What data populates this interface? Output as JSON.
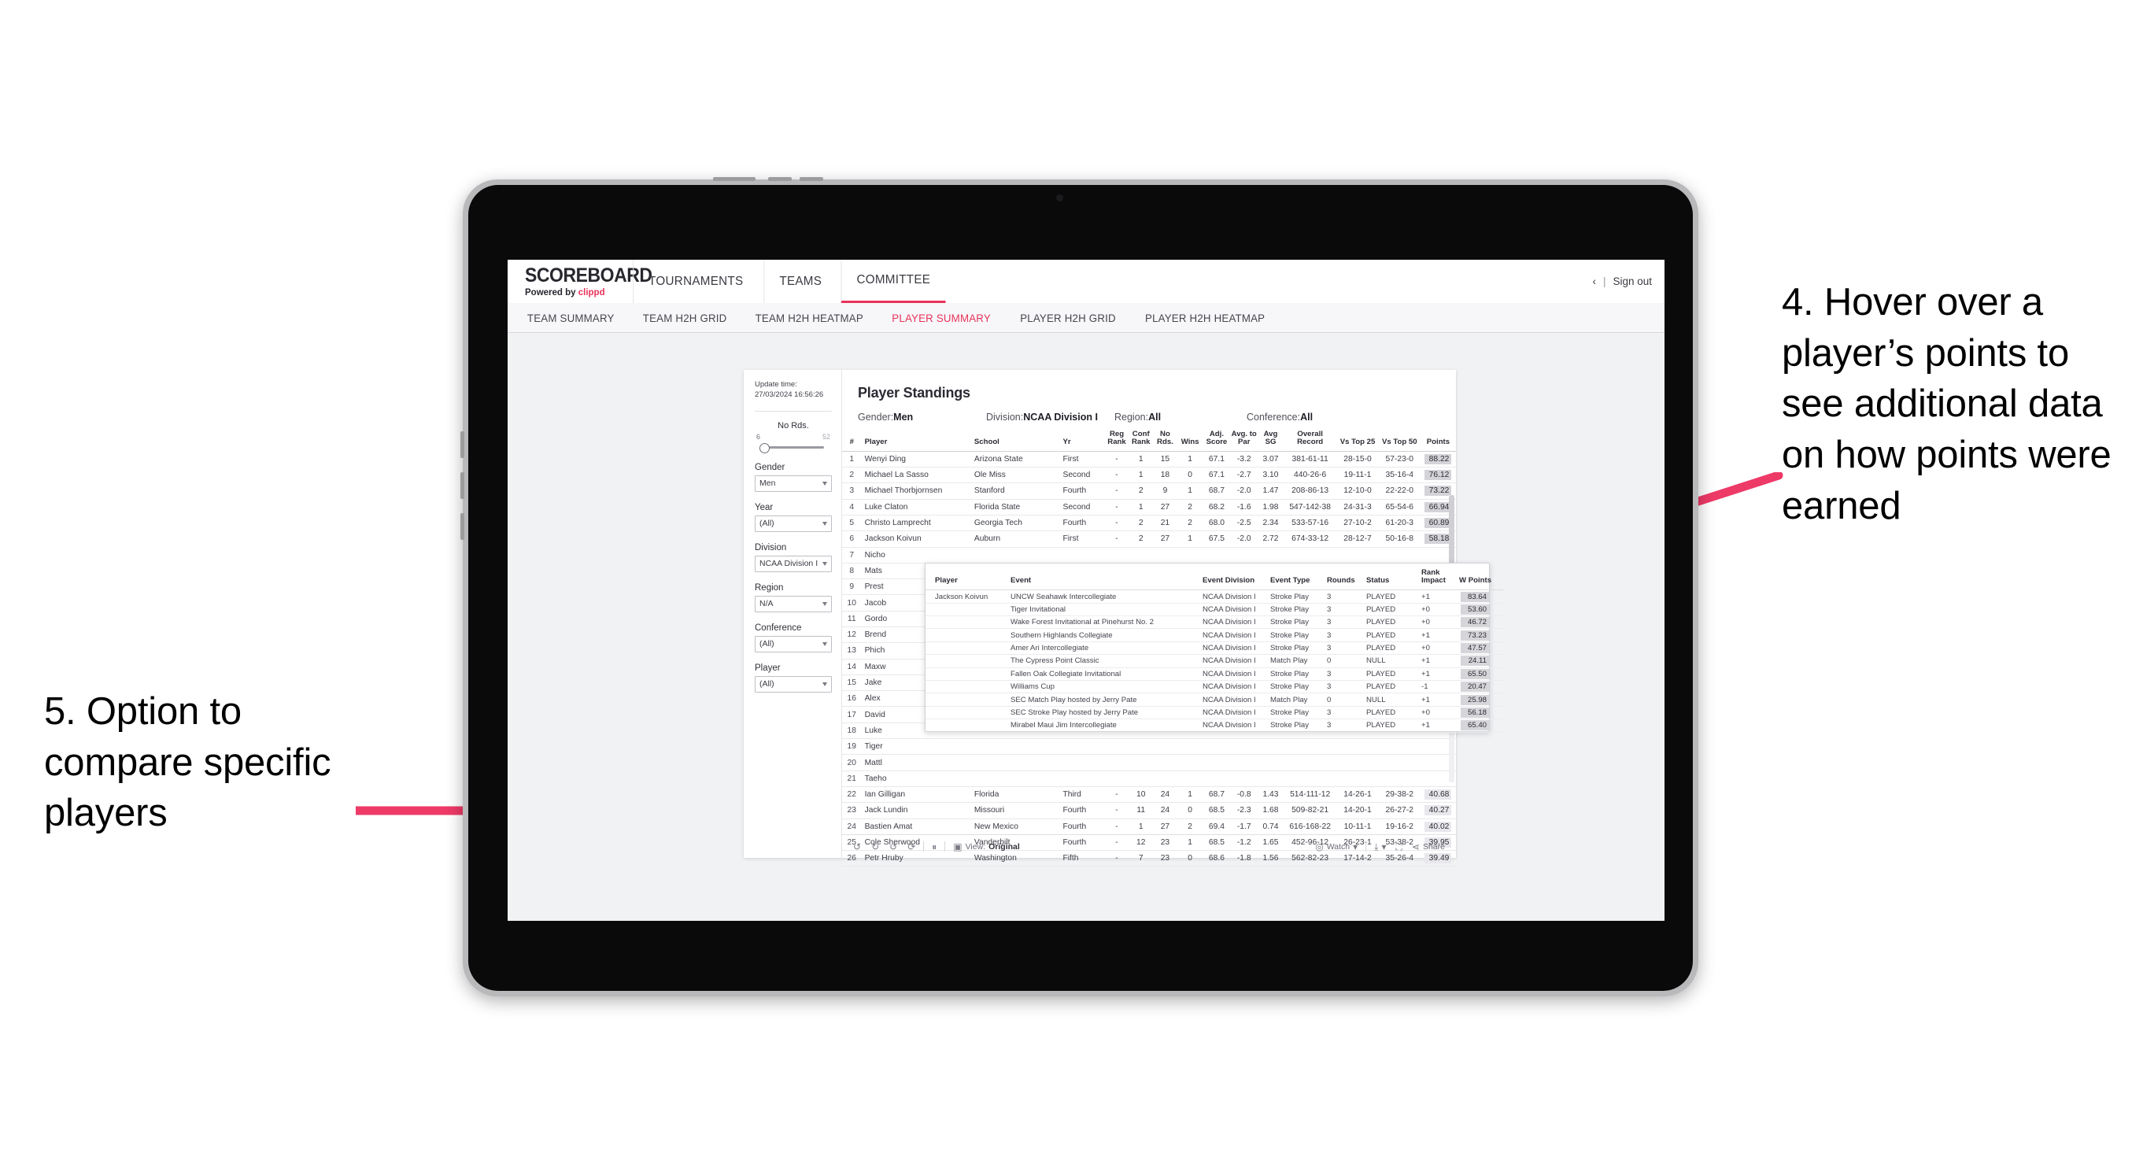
{
  "annotations": {
    "right": "4. Hover over a player’s points to see additional data on how points were earned",
    "left": "5. Option to compare specific players",
    "arrow_color": "#EE3A67"
  },
  "header": {
    "brand_title": "SCOREBOARD",
    "brand_sub_prefix": "Powered by ",
    "brand_sub_brand": "clippd",
    "nav": [
      {
        "label": "TOURNAMENTS",
        "active": false
      },
      {
        "label": "TEAMS",
        "active": false
      },
      {
        "label": "COMMITTEE",
        "active": true
      }
    ],
    "account_chevron": "‹",
    "separator": "|",
    "sign_out": "Sign out"
  },
  "subnav": [
    {
      "label": "TEAM SUMMARY",
      "active": false
    },
    {
      "label": "TEAM H2H GRID",
      "active": false
    },
    {
      "label": "TEAM H2H HEATMAP",
      "active": false
    },
    {
      "label": "PLAYER SUMMARY",
      "active": true
    },
    {
      "label": "PLAYER H2H GRID",
      "active": false
    },
    {
      "label": "PLAYER H2H HEATMAP",
      "active": false
    }
  ],
  "sidebar": {
    "update_time_label": "Update time:",
    "update_time_value": "27/03/2024 16:56:26",
    "slider": {
      "title": "No Rds.",
      "min": "6",
      "max": "52"
    },
    "filters": [
      {
        "label": "Gender",
        "value": "Men"
      },
      {
        "label": "Year",
        "value": "(All)"
      },
      {
        "label": "Division",
        "value": "NCAA Division I"
      },
      {
        "label": "Region",
        "value": "N/A"
      },
      {
        "label": "Conference",
        "value": "(All)"
      },
      {
        "label": "Player",
        "value": "(All)"
      }
    ]
  },
  "viz": {
    "title": "Player Standings",
    "filters": [
      {
        "label": "Gender: ",
        "value": "Men"
      },
      {
        "label": "Division: ",
        "value": "NCAA Division I"
      },
      {
        "label": "Region: ",
        "value": "All"
      },
      {
        "label": "Conference: ",
        "value": "All"
      }
    ],
    "columns": [
      "#",
      "Player",
      "School",
      "Yr",
      "Reg Rank",
      "Conf Rank",
      "No Rds.",
      "Wins",
      "Adj. Score",
      "Avg. to Par",
      "Avg SG",
      "Overall Record",
      "Vs Top 25",
      "Vs Top 50",
      "Points"
    ],
    "rows": [
      {
        "n": "1",
        "player": "Wenyi Ding",
        "school": "Arizona State",
        "yr": "First",
        "reg": "-",
        "conf": "1",
        "rds": "15",
        "wins": "1",
        "adj": "67.1",
        "par": "-3.2",
        "sg": "3.07",
        "rec": "381-61-11",
        "t25": "28-15-0",
        "t50": "57-23-0",
        "pts": "88.22"
      },
      {
        "n": "2",
        "player": "Michael La Sasso",
        "school": "Ole Miss",
        "yr": "Second",
        "reg": "-",
        "conf": "1",
        "rds": "18",
        "wins": "0",
        "adj": "67.1",
        "par": "-2.7",
        "sg": "3.10",
        "rec": "440-26-6",
        "t25": "19-11-1",
        "t50": "35-16-4",
        "pts": "76.12"
      },
      {
        "n": "3",
        "player": "Michael Thorbjornsen",
        "school": "Stanford",
        "yr": "Fourth",
        "reg": "-",
        "conf": "2",
        "rds": "9",
        "wins": "1",
        "adj": "68.7",
        "par": "-2.0",
        "sg": "1.47",
        "rec": "208-86-13",
        "t25": "12-10-0",
        "t50": "22-22-0",
        "pts": "73.22"
      },
      {
        "n": "4",
        "player": "Luke Claton",
        "school": "Florida State",
        "yr": "Second",
        "reg": "-",
        "conf": "1",
        "rds": "27",
        "wins": "2",
        "adj": "68.2",
        "par": "-1.6",
        "sg": "1.98",
        "rec": "547-142-38",
        "t25": "24-31-3",
        "t50": "65-54-6",
        "pts": "66.94"
      },
      {
        "n": "5",
        "player": "Christo Lamprecht",
        "school": "Georgia Tech",
        "yr": "Fourth",
        "reg": "-",
        "conf": "2",
        "rds": "21",
        "wins": "2",
        "adj": "68.0",
        "par": "-2.5",
        "sg": "2.34",
        "rec": "533-57-16",
        "t25": "27-10-2",
        "t50": "61-20-3",
        "pts": "60.89"
      },
      {
        "n": "6",
        "player": "Jackson Koivun",
        "school": "Auburn",
        "yr": "First",
        "reg": "-",
        "conf": "2",
        "rds": "27",
        "wins": "1",
        "adj": "67.5",
        "par": "-2.0",
        "sg": "2.72",
        "rec": "674-33-12",
        "t25": "28-12-7",
        "t50": "50-16-8",
        "pts": "58.18"
      },
      {
        "n": "7",
        "player": "Nicho",
        "school": "",
        "yr": "",
        "reg": "",
        "conf": "",
        "rds": "",
        "wins": "",
        "adj": "",
        "par": "",
        "sg": "",
        "rec": "",
        "t25": "",
        "t50": "",
        "pts": ""
      },
      {
        "n": "8",
        "player": "Mats",
        "school": "",
        "yr": "",
        "reg": "",
        "conf": "",
        "rds": "",
        "wins": "",
        "adj": "",
        "par": "",
        "sg": "",
        "rec": "",
        "t25": "",
        "t50": "",
        "pts": ""
      },
      {
        "n": "9",
        "player": "Prest",
        "school": "",
        "yr": "",
        "reg": "",
        "conf": "",
        "rds": "",
        "wins": "",
        "adj": "",
        "par": "",
        "sg": "",
        "rec": "",
        "t25": "",
        "t50": "",
        "pts": ""
      },
      {
        "n": "10",
        "player": "Jacob",
        "school": "",
        "yr": "",
        "reg": "",
        "conf": "",
        "rds": "",
        "wins": "",
        "adj": "",
        "par": "",
        "sg": "",
        "rec": "",
        "t25": "",
        "t50": "",
        "pts": ""
      },
      {
        "n": "11",
        "player": "Gordo",
        "school": "",
        "yr": "",
        "reg": "",
        "conf": "",
        "rds": "",
        "wins": "",
        "adj": "",
        "par": "",
        "sg": "",
        "rec": "",
        "t25": "",
        "t50": "",
        "pts": ""
      },
      {
        "n": "12",
        "player": "Brend",
        "school": "",
        "yr": "",
        "reg": "",
        "conf": "",
        "rds": "",
        "wins": "",
        "adj": "",
        "par": "",
        "sg": "",
        "rec": "",
        "t25": "",
        "t50": "",
        "pts": ""
      },
      {
        "n": "13",
        "player": "Phich",
        "school": "",
        "yr": "",
        "reg": "",
        "conf": "",
        "rds": "",
        "wins": "",
        "adj": "",
        "par": "",
        "sg": "",
        "rec": "",
        "t25": "",
        "t50": "",
        "pts": ""
      },
      {
        "n": "14",
        "player": "Maxw",
        "school": "",
        "yr": "",
        "reg": "",
        "conf": "",
        "rds": "",
        "wins": "",
        "adj": "",
        "par": "",
        "sg": "",
        "rec": "",
        "t25": "",
        "t50": "",
        "pts": ""
      },
      {
        "n": "15",
        "player": "Jake",
        "school": "",
        "yr": "",
        "reg": "",
        "conf": "",
        "rds": "",
        "wins": "",
        "adj": "",
        "par": "",
        "sg": "",
        "rec": "",
        "t25": "",
        "t50": "",
        "pts": ""
      },
      {
        "n": "16",
        "player": "Alex",
        "school": "",
        "yr": "",
        "reg": "",
        "conf": "",
        "rds": "",
        "wins": "",
        "adj": "",
        "par": "",
        "sg": "",
        "rec": "",
        "t25": "",
        "t50": "",
        "pts": ""
      },
      {
        "n": "17",
        "player": "David",
        "school": "",
        "yr": "",
        "reg": "",
        "conf": "",
        "rds": "",
        "wins": "",
        "adj": "",
        "par": "",
        "sg": "",
        "rec": "",
        "t25": "",
        "t50": "",
        "pts": ""
      },
      {
        "n": "18",
        "player": "Luke",
        "school": "",
        "yr": "",
        "reg": "",
        "conf": "",
        "rds": "",
        "wins": "",
        "adj": "",
        "par": "",
        "sg": "",
        "rec": "",
        "t25": "",
        "t50": "",
        "pts": ""
      },
      {
        "n": "19",
        "player": "Tiger",
        "school": "",
        "yr": "",
        "reg": "",
        "conf": "",
        "rds": "",
        "wins": "",
        "adj": "",
        "par": "",
        "sg": "",
        "rec": "",
        "t25": "",
        "t50": "",
        "pts": ""
      },
      {
        "n": "20",
        "player": "Mattl",
        "school": "",
        "yr": "",
        "reg": "",
        "conf": "",
        "rds": "",
        "wins": "",
        "adj": "",
        "par": "",
        "sg": "",
        "rec": "",
        "t25": "",
        "t50": "",
        "pts": ""
      },
      {
        "n": "21",
        "player": "Taeho",
        "school": "",
        "yr": "",
        "reg": "",
        "conf": "",
        "rds": "",
        "wins": "",
        "adj": "",
        "par": "",
        "sg": "",
        "rec": "",
        "t25": "",
        "t50": "",
        "pts": ""
      },
      {
        "n": "22",
        "player": "Ian Gilligan",
        "school": "Florida",
        "yr": "Third",
        "reg": "-",
        "conf": "10",
        "rds": "24",
        "wins": "1",
        "adj": "68.7",
        "par": "-0.8",
        "sg": "1.43",
        "rec": "514-111-12",
        "t25": "14-26-1",
        "t50": "29-38-2",
        "pts": "40.68"
      },
      {
        "n": "23",
        "player": "Jack Lundin",
        "school": "Missouri",
        "yr": "Fourth",
        "reg": "-",
        "conf": "11",
        "rds": "24",
        "wins": "0",
        "adj": "68.5",
        "par": "-2.3",
        "sg": "1.68",
        "rec": "509-82-21",
        "t25": "14-20-1",
        "t50": "26-27-2",
        "pts": "40.27"
      },
      {
        "n": "24",
        "player": "Bastien Amat",
        "school": "New Mexico",
        "yr": "Fourth",
        "reg": "-",
        "conf": "1",
        "rds": "27",
        "wins": "2",
        "adj": "69.4",
        "par": "-1.7",
        "sg": "0.74",
        "rec": "616-168-22",
        "t25": "10-11-1",
        "t50": "19-16-2",
        "pts": "40.02"
      },
      {
        "n": "25",
        "player": "Cole Sherwood",
        "school": "Vanderbilt",
        "yr": "Fourth",
        "reg": "-",
        "conf": "12",
        "rds": "23",
        "wins": "1",
        "adj": "68.5",
        "par": "-1.2",
        "sg": "1.65",
        "rec": "452-96-12",
        "t25": "26-23-1",
        "t50": "53-38-2",
        "pts": "39.95"
      },
      {
        "n": "26",
        "player": "Petr Hruby",
        "school": "Washington",
        "yr": "Fifth",
        "reg": "-",
        "conf": "7",
        "rds": "23",
        "wins": "0",
        "adj": "68.6",
        "par": "-1.8",
        "sg": "1.56",
        "rec": "562-82-23",
        "t25": "17-14-2",
        "t50": "35-26-4",
        "pts": "39.49"
      }
    ]
  },
  "popup": {
    "columns": [
      "Player",
      "Event",
      "Event Division",
      "Event Type",
      "Rounds",
      "Status",
      "Rank Impact",
      "W Points"
    ],
    "player": "Jackson Koivun",
    "rows": [
      {
        "event": "UNCW Seahawk Intercollegiate",
        "division": "NCAA Division I",
        "type": "Stroke Play",
        "rounds": "3",
        "status": "PLAYED",
        "rank": "+1",
        "points": "83.64"
      },
      {
        "event": "Tiger Invitational",
        "division": "NCAA Division I",
        "type": "Stroke Play",
        "rounds": "3",
        "status": "PLAYED",
        "rank": "+0",
        "points": "53.60"
      },
      {
        "event": "Wake Forest Invitational at Pinehurst No. 2",
        "division": "NCAA Division I",
        "type": "Stroke Play",
        "rounds": "3",
        "status": "PLAYED",
        "rank": "+0",
        "points": "46.72"
      },
      {
        "event": "Southern Highlands Collegiate",
        "division": "NCAA Division I",
        "type": "Stroke Play",
        "rounds": "3",
        "status": "PLAYED",
        "rank": "+1",
        "points": "73.23"
      },
      {
        "event": "Amer Ari Intercollegiate",
        "division": "NCAA Division I",
        "type": "Stroke Play",
        "rounds": "3",
        "status": "PLAYED",
        "rank": "+0",
        "points": "47.57"
      },
      {
        "event": "The Cypress Point Classic",
        "division": "NCAA Division I",
        "type": "Match Play",
        "rounds": "0",
        "status": "NULL",
        "rank": "+1",
        "points": "24.11"
      },
      {
        "event": "Fallen Oak Collegiate Invitational",
        "division": "NCAA Division I",
        "type": "Stroke Play",
        "rounds": "3",
        "status": "PLAYED",
        "rank": "+1",
        "points": "65.50"
      },
      {
        "event": "Williams Cup",
        "division": "NCAA Division I",
        "type": "Stroke Play",
        "rounds": "3",
        "status": "PLAYED",
        "rank": "-1",
        "points": "20.47"
      },
      {
        "event": "SEC Match Play hosted by Jerry Pate",
        "division": "NCAA Division I",
        "type": "Match Play",
        "rounds": "0",
        "status": "NULL",
        "rank": "+1",
        "points": "25.98"
      },
      {
        "event": "SEC Stroke Play hosted by Jerry Pate",
        "division": "NCAA Division I",
        "type": "Stroke Play",
        "rounds": "3",
        "status": "PLAYED",
        "rank": "+0",
        "points": "56.18"
      },
      {
        "event": "Mirabel Maui Jim Intercollegiate",
        "division": "NCAA Division I",
        "type": "Stroke Play",
        "rounds": "3",
        "status": "PLAYED",
        "rank": "+1",
        "points": "65.40"
      }
    ]
  },
  "toolbar": {
    "undo_icon": "↺",
    "redo_icon": "↻",
    "revert_icon": "↺",
    "refresh_icon": "⟳",
    "pause_icon": "⏸",
    "view_icon": "▣",
    "view_label_prefix": "View: ",
    "view_label_value": "Original",
    "watch_icon": "◎",
    "watch_label": "Watch",
    "watch_caret": "▾",
    "download_icon": "⤓",
    "download_caret": "▾",
    "fullscreen_icon": "⛶",
    "share_icon": "⋖",
    "share_label": "Share"
  }
}
